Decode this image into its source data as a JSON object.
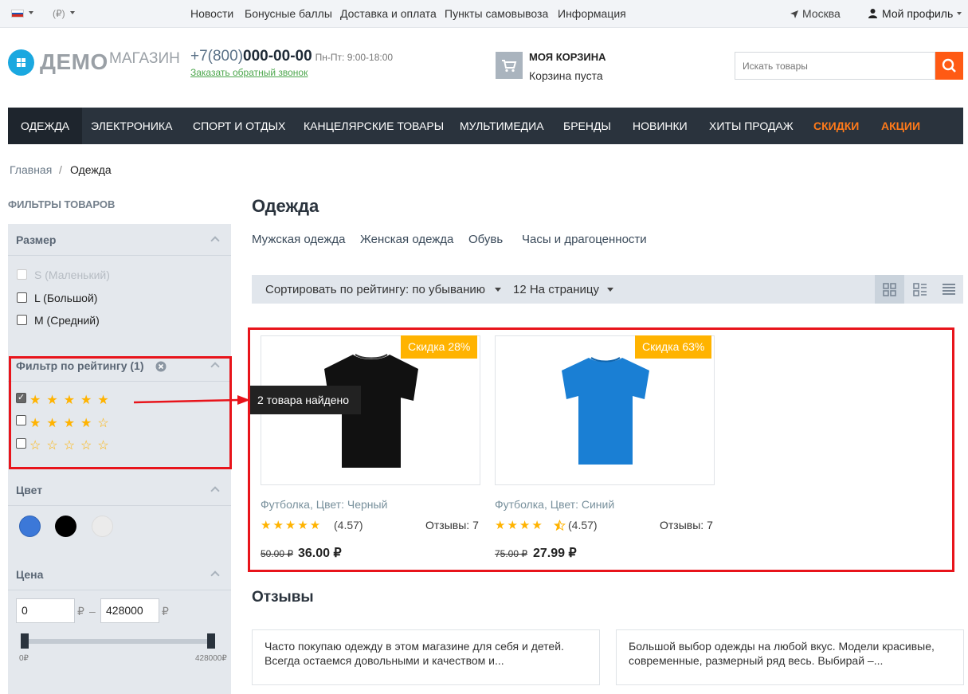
{
  "topbar": {
    "currency": "(₽)",
    "links": [
      "Новости",
      "Бонусные баллы",
      "Доставка и оплата",
      "Пункты самовывоза",
      "Информация"
    ],
    "city": "Москва",
    "profile": "Мой профиль"
  },
  "header": {
    "logo_main": "ДЕМО",
    "logo_sub": "МАГАЗИН",
    "phone_prefix": "+7(800)",
    "phone_number": "000-00-00",
    "phone_hours": "Пн-Пт: 9:00-18:00",
    "callback": "Заказать обратный звонок",
    "cart_title": "МОЯ КОРЗИНА",
    "cart_status": "Корзина пуста",
    "search_placeholder": "Искать товары"
  },
  "nav": {
    "items": [
      "ОДЕЖДА",
      "ЭЛЕКТРОНИКА",
      "СПОРТ И ОТДЫХ",
      "КАНЦЕЛЯРСКИЕ ТОВАРЫ",
      "МУЛЬТИМЕДИА",
      "БРЕНДЫ",
      "НОВИНКИ",
      "ХИТЫ ПРОДАЖ",
      "СКИДКИ",
      "АКЦИИ"
    ]
  },
  "breadcrumb": {
    "home": "Главная",
    "sep": "/",
    "current": "Одежда"
  },
  "sidebar": {
    "title": "ФИЛЬТРЫ ТОВАРОВ",
    "size": {
      "title": "Размер",
      "options": [
        "S (Маленький)",
        "L (Большой)",
        "M (Средний)"
      ]
    },
    "rating": {
      "title": "Фильтр по рейтингу (1)",
      "checked": [
        true,
        false,
        false
      ],
      "rows": [
        "★★★★★",
        "★★★★☆",
        "☆☆☆☆☆"
      ]
    },
    "color": {
      "title": "Цвет",
      "swatches": [
        "#3c78d8",
        "#000000",
        "#ebebeb"
      ]
    },
    "price": {
      "title": "Цена",
      "min": "0",
      "max": "428000",
      "currency": "₽",
      "dash": "–",
      "min_label": "0₽",
      "max_label": "428000₽"
    }
  },
  "main": {
    "title": "Одежда",
    "subcategories": [
      "Мужская одежда",
      "Женская одежда",
      "Обувь",
      "Часы и драгоценности"
    ],
    "sort_label": "Сортировать по рейтингу: по убыванию",
    "per_page": "12 На страницу",
    "tooltip": "2 товара найдено",
    "products": [
      {
        "badge": "Скидка 28%",
        "name": "Футболка, Цвет: Черный",
        "stars": "★★★★★",
        "rating": "(4.57)",
        "reviews": "Отзывы: 7",
        "old_price": "50.00 ₽",
        "price": "36.00 ₽",
        "color": "#111111"
      },
      {
        "badge": "Скидка 63%",
        "name": "Футболка, Цвет: Синий",
        "stars": "★★★★",
        "rating": "(4.57)",
        "reviews": "Отзывы: 7",
        "old_price": "75.00 ₽",
        "price": "27.99 ₽",
        "color": "#1a7fd4"
      }
    ],
    "reviews_title": "Отзывы",
    "reviews": [
      "Часто покупаю одежду в этом магазине для себя и детей. Всегда остаемся довольными и качеством и...",
      "Большой выбор одежды на любой вкус. Модели красивые, современные, размерный ряд весь. Выбирай –..."
    ]
  }
}
